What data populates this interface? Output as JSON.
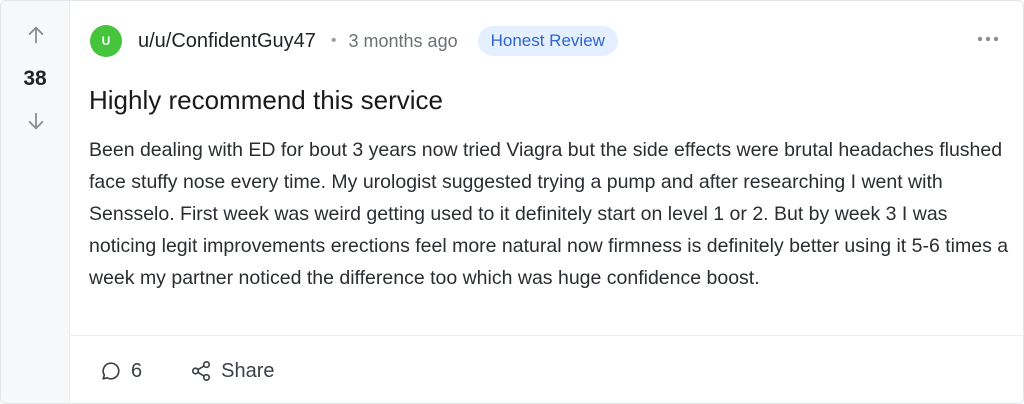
{
  "post": {
    "votes": "38",
    "author": {
      "avatar_letter": "U",
      "username": "u/u/ConfidentGuy47",
      "avatar_color": "#46c43b"
    },
    "separator": "•",
    "time": "3 months ago",
    "flair": "Honest Review",
    "title": "Highly recommend this service",
    "body": "Been dealing with ED for bout 3 years now tried Viagra but the side effects were brutal headaches flushed face stuffy nose every time. My urologist suggested trying a pump and after researching I went with Sensselo. First week was weird getting used to it definitely start on level 1 or 2. But by week 3 I was noticing legit improvements erections feel more natural now firmness is definitely better using it 5-6 times a week my partner noticed the difference too which was huge confidence boost.",
    "comments_count": "6",
    "share_label": "Share"
  },
  "icons": {
    "upvote": "arrow-up-icon",
    "downvote": "arrow-down-icon",
    "more": "more-horizontal-icon",
    "comment": "comment-icon",
    "share": "share-icon"
  },
  "colors": {
    "flair_bg": "#e4efff",
    "flair_text": "#2f66d0"
  }
}
